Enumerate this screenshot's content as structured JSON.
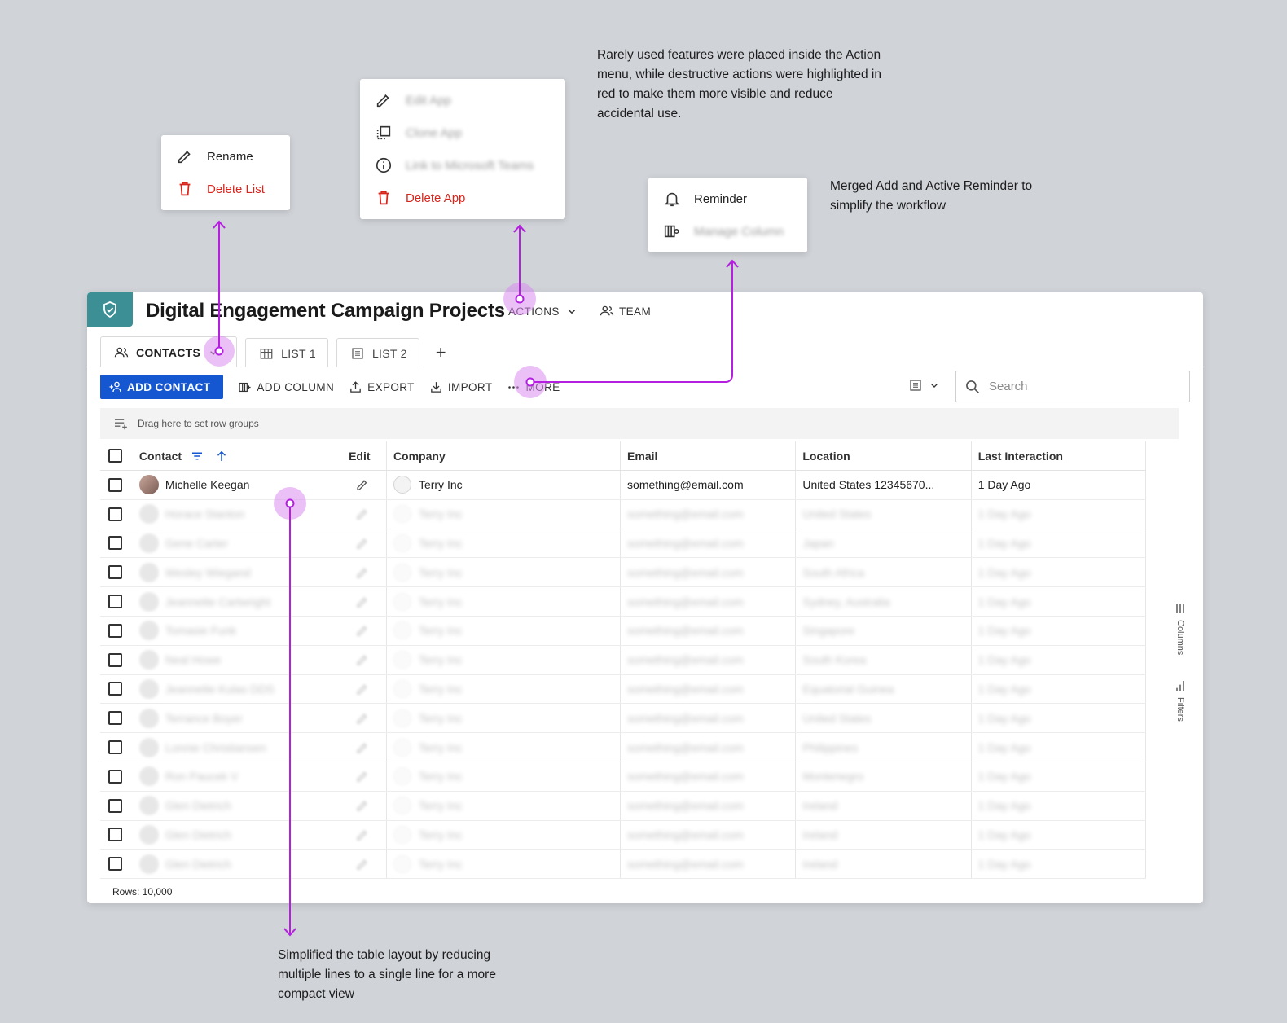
{
  "notes": {
    "actions": "Rarely used features were placed inside the Action menu, while destructive actions were highlighted in red to make them more visible and reduce accidental use.",
    "reminder": "Merged Add and Active Reminder to simplify the workflow",
    "table": "Simplified the table layout by reducing multiple lines to a single line for a more compact view"
  },
  "list_menu": {
    "rename": "Rename",
    "delete": "Delete List"
  },
  "actions_menu": {
    "edit": "Edit App",
    "clone": "Clone App",
    "link": "Link to Microsoft Teams",
    "delete": "Delete App"
  },
  "more_menu": {
    "reminder": "Reminder",
    "manage": "Manage Column"
  },
  "header": {
    "title": "Digital Engagement Campaign Projects",
    "actions": "ACTIONS",
    "team": "TEAM"
  },
  "tabs": {
    "contacts": "CONTACTS",
    "list1": "LIST 1",
    "list2": "LIST 2",
    "add": "+"
  },
  "toolbar": {
    "add_contact": "ADD CONTACT",
    "add_column": "ADD COLUMN",
    "export": "EXPORT",
    "import": "IMPORT",
    "more": "MORE",
    "search_placeholder": "Search"
  },
  "group_bar": "Drag here to set row groups",
  "columns": {
    "contact": "Contact",
    "edit": "Edit",
    "company": "Company",
    "email": "Email",
    "location": "Location",
    "last": "Last Interaction"
  },
  "rows": [
    {
      "name": "Michelle Keegan",
      "company": "Terry Inc",
      "email": "something@email.com",
      "location": "United States 12345670...",
      "last": "1 Day Ago"
    },
    {
      "name": "Horace Stanton",
      "company": "Terry Inc",
      "email": "something@email.com",
      "location": "United States",
      "last": "1 Day Ago"
    },
    {
      "name": "Gene Carter",
      "company": "Terry Inc",
      "email": "something@email.com",
      "location": "Japan",
      "last": "1 Day Ago"
    },
    {
      "name": "Wesley Wiegand",
      "company": "Terry Inc",
      "email": "something@email.com",
      "location": "South Africa",
      "last": "1 Day Ago"
    },
    {
      "name": "Jeannette Cartwright",
      "company": "Terry Inc",
      "email": "something@email.com",
      "location": "Sydney, Australia",
      "last": "1 Day Ago"
    },
    {
      "name": "Tomasie Funk",
      "company": "Terry Inc",
      "email": "something@email.com",
      "location": "Singapore",
      "last": "1 Day Ago"
    },
    {
      "name": "Neal Howe",
      "company": "Terry Inc",
      "email": "something@email.com",
      "location": "South Korea",
      "last": "1 Day Ago"
    },
    {
      "name": "Jeannette Kulas DDS",
      "company": "Terry Inc",
      "email": "something@email.com",
      "location": "Equatorial Guinea",
      "last": "1 Day Ago"
    },
    {
      "name": "Terrance Boyer",
      "company": "Terry Inc",
      "email": "something@email.com",
      "location": "United States",
      "last": "1 Day Ago"
    },
    {
      "name": "Lonnie Christiansen",
      "company": "Terry Inc",
      "email": "something@email.com",
      "location": "Philippines",
      "last": "1 Day Ago"
    },
    {
      "name": "Ron Paucek V",
      "company": "Terry Inc",
      "email": "something@email.com",
      "location": "Montenegro",
      "last": "1 Day Ago"
    },
    {
      "name": "Glen Dietrich",
      "company": "Terry Inc",
      "email": "something@email.com",
      "location": "Ireland",
      "last": "1 Day Ago"
    },
    {
      "name": "Glen Dietrich",
      "company": "Terry Inc",
      "email": "something@email.com",
      "location": "Ireland",
      "last": "1 Day Ago"
    },
    {
      "name": "Glen Dietrich",
      "company": "Terry Inc",
      "email": "something@email.com",
      "location": "Ireland",
      "last": "1 Day Ago"
    }
  ],
  "side_panel": {
    "columns": "Columns",
    "filters": "Filters"
  },
  "footer": {
    "rows": "Rows: 10,000"
  },
  "colors": {
    "primary": "#1556d1",
    "accent": "#3b8f95",
    "danger": "#d8261d",
    "annotation": "#b41fe0"
  },
  "icons": [
    "pencil-icon",
    "trash-icon",
    "clone-icon",
    "info-icon",
    "bell-icon",
    "manage-column-icon",
    "shield-icon",
    "team-icon",
    "building-icon",
    "list-icon",
    "add-user-icon",
    "search-icon",
    "filter-icon",
    "arrow-up-icon"
  ]
}
